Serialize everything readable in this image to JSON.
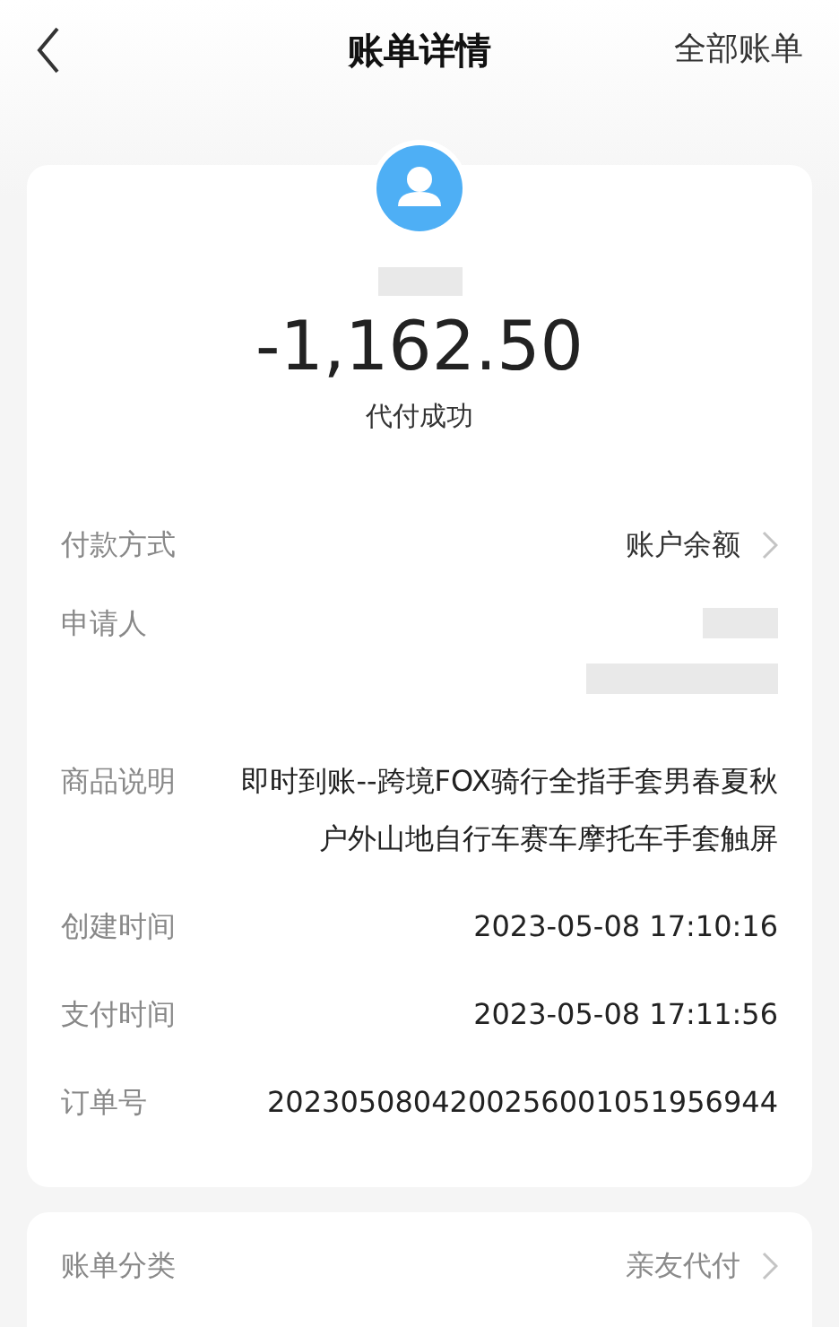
{
  "header": {
    "title": "账单详情",
    "action": "全部账单"
  },
  "summary": {
    "amount": "-1,162.50",
    "status": "代付成功"
  },
  "details": [
    {
      "kind": "link",
      "label": "付款方式",
      "value": "账户余额"
    },
    {
      "kind": "redacted",
      "label": "申请人"
    },
    {
      "kind": "text",
      "label": "商品说明",
      "value": "即时到账--跨境FOX骑行全指手套男春夏秋户外山地自行车赛车摩托车手套触屏"
    },
    {
      "kind": "text",
      "label": "创建时间",
      "value": "2023-05-08 17:10:16"
    },
    {
      "kind": "text",
      "label": "支付时间",
      "value": "2023-05-08 17:11:56"
    },
    {
      "kind": "text",
      "label": "订单号",
      "value": "2023050804200256001051956944"
    }
  ],
  "category": {
    "kind": "link",
    "label": "账单分类",
    "value": "亲友代付"
  }
}
